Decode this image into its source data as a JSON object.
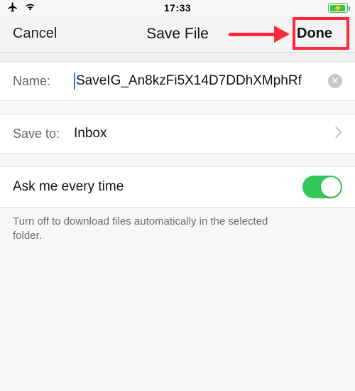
{
  "statusbar": {
    "time": "17:33"
  },
  "nav": {
    "cancel": "Cancel",
    "title": "Save File",
    "done": "Done"
  },
  "name_row": {
    "label": "Name:",
    "value": "SaveIG_An8kzFi5X14D7DDhXMphRf"
  },
  "saveto_row": {
    "label": "Save to:",
    "value": "Inbox"
  },
  "toggle": {
    "label": "Ask me every time",
    "on": true
  },
  "footer": "Turn off to download files automatically in the selected folder."
}
